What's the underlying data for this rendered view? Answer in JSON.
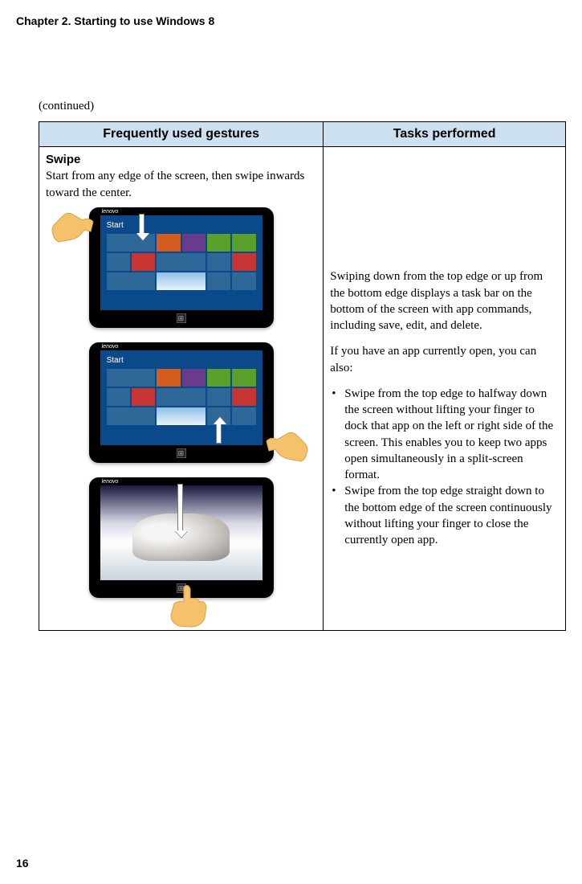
{
  "chapter_title": "Chapter 2. Starting to use Windows 8",
  "continued": "(continued)",
  "table": {
    "header_left": "Frequently used gestures",
    "header_right": "Tasks performed",
    "gesture_name": "Swipe",
    "gesture_desc": "Start from any edge of the screen, then swipe inwards toward the center.",
    "brand": "lenovo",
    "start_label": "Start",
    "right_p1": "Swiping down from the top edge or up from the bottom edge displays a task bar on the bottom of the screen with app commands, including save, edit, and delete.",
    "right_p2": "If you have an app currently open, you can also:",
    "right_li1": "Swipe from the top edge to halfway down the screen without lifting your finger to dock that app on the left or right side of the screen. This enables you to keep two apps open simultaneously in a split-screen format.",
    "right_li2": "Swipe from the top edge straight down to the bottom edge of the screen continuously without lifting your finger to close the currently open app."
  },
  "page_number": "16"
}
